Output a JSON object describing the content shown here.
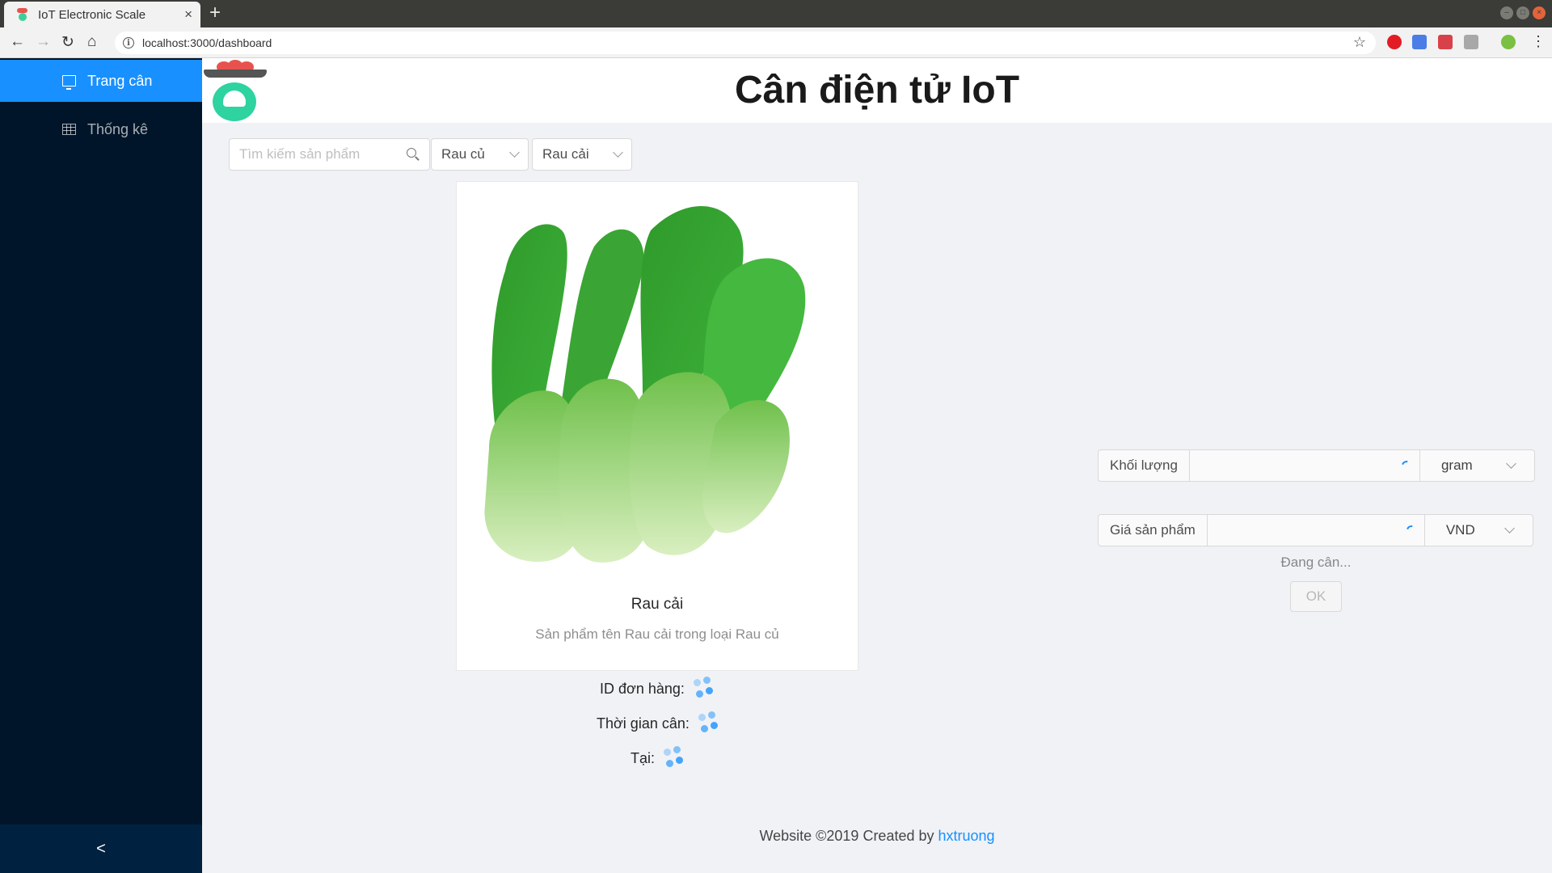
{
  "browser": {
    "tab_title": "IoT Electronic Scale",
    "tab_close": "×",
    "new_tab": "+",
    "url": "localhost:3000/dashboard"
  },
  "sidebar": {
    "items": [
      {
        "label": "Trang cân",
        "icon": "desktop-icon",
        "active": true
      },
      {
        "label": "Thống kê",
        "icon": "table-icon",
        "active": false
      }
    ],
    "collapse_label": "<"
  },
  "header": {
    "title": "Cân điện tử IoT"
  },
  "search": {
    "placeholder": "Tìm kiếm sản phẩm"
  },
  "filters": {
    "category": "Rau củ",
    "product": "Rau cải"
  },
  "product": {
    "name": "Rau cải",
    "description": "Sản phẩm tên Rau cải trong loại Rau củ"
  },
  "order_info": {
    "id_label": "ID đơn hàng",
    "time_label": "Thời gian cân",
    "location_label": "Tại",
    "separator": ":"
  },
  "weigh_form": {
    "weight_label": "Khối lượng",
    "weight_unit": "gram",
    "price_label": "Giá sản phẩm",
    "price_unit": "VND",
    "status": "Đang cân...",
    "ok_label": "OK"
  },
  "footer": {
    "text": "Website ©2019 Created by ",
    "author": "hxtruong"
  },
  "colors": {
    "primary": "#1890ff",
    "sider": "#001529",
    "sider_trigger": "#002140",
    "logo_green": "#2ed3a0",
    "logo_red": "#e8524e"
  }
}
